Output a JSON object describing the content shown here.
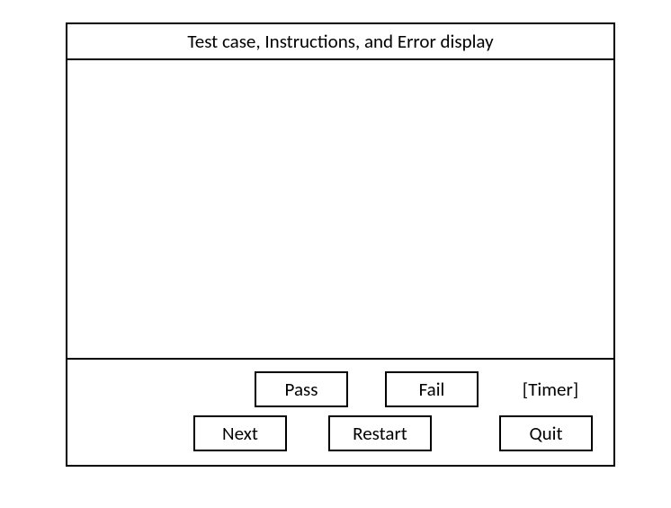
{
  "header": {
    "title": "Test case, Instructions, and Error display"
  },
  "footer": {
    "pass_label": "Pass",
    "fail_label": "Fail",
    "timer_label": "[Timer]",
    "next_label": "Next",
    "restart_label": "Restart",
    "quit_label": "Quit"
  }
}
